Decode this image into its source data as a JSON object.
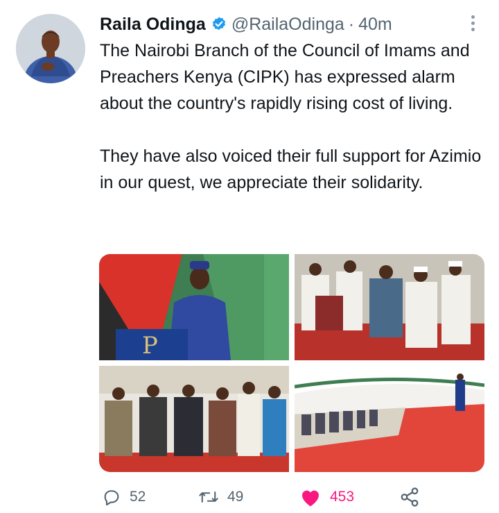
{
  "tweet": {
    "author_name": "Raila Odinga",
    "handle": "@RailaOdinga",
    "separator": "·",
    "time": "40m",
    "verified": true,
    "text": "The Nairobi Branch of the Council of Imams and Preachers Kenya (CIPK) has expressed alarm about the country's rapidly rising cost of living.\n\nThey have also voiced their full support for Azimio in our quest, we appreciate their solidarity.",
    "photos": [
      {
        "label": "photo-speaker-at-podium"
      },
      {
        "label": "photo-seated-audience-closeup"
      },
      {
        "label": "photo-front-row-guests"
      },
      {
        "label": "photo-wide-tent-audience"
      }
    ]
  },
  "actions": {
    "replies": "52",
    "retweets": "49",
    "likes": "453",
    "share": ""
  },
  "colors": {
    "verified": "#1d9bf0",
    "like": "#f91880",
    "secondary_text": "#536471"
  },
  "icons": [
    "verified-badge-icon",
    "more-options-icon",
    "reply-icon",
    "retweet-icon",
    "like-heart-icon",
    "share-icon"
  ]
}
